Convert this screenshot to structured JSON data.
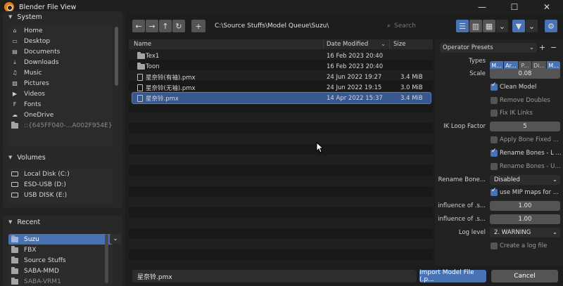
{
  "window": {
    "title": "Blender File View",
    "minimize": "—",
    "maximize": "☐",
    "close": "✕"
  },
  "sidebar": {
    "system": {
      "header": "System",
      "items": [
        {
          "label": "Home",
          "icon": "home-icon",
          "glyph": "⌂"
        },
        {
          "label": "Desktop",
          "icon": "desktop-icon",
          "glyph": "▭"
        },
        {
          "label": "Documents",
          "icon": "documents-icon",
          "glyph": "▤"
        },
        {
          "label": "Downloads",
          "icon": "downloads-icon",
          "glyph": "⤓"
        },
        {
          "label": "Music",
          "icon": "music-icon",
          "glyph": "♫"
        },
        {
          "label": "Pictures",
          "icon": "pictures-icon",
          "glyph": "▨"
        },
        {
          "label": "Videos",
          "icon": "videos-icon",
          "glyph": "▶"
        },
        {
          "label": "Fonts",
          "icon": "fonts-icon",
          "glyph": "F"
        },
        {
          "label": "OneDrive",
          "icon": "onedrive-icon",
          "glyph": "☁"
        },
        {
          "label": "::{645FF040-...A002F954E}",
          "icon": "folder-icon",
          "glyph": ""
        }
      ]
    },
    "volumes": {
      "header": "Volumes",
      "items": [
        {
          "label": "Local Disk (C:)"
        },
        {
          "label": "ESD-USB (D:)"
        },
        {
          "label": "USB DISK (E:)"
        }
      ]
    },
    "recent": {
      "header": "Recent",
      "items": [
        {
          "label": "Suzu"
        },
        {
          "label": "FBX"
        },
        {
          "label": "Source Stuffs"
        },
        {
          "label": "SABA-MMD"
        },
        {
          "label": "SABA-VRM1"
        }
      ]
    }
  },
  "toolbar": {
    "back": "←",
    "forward": "→",
    "parent": "↑",
    "refresh": "↻",
    "new_folder": "+",
    "path": "C:\\Source Stuffs\\Model Queue\\Suzu\\",
    "search_placeholder": "Search",
    "dropdown": "⌄",
    "filter": "▼",
    "gear": "⚙"
  },
  "files": {
    "columns": {
      "name": "Name",
      "date": "Date Modified",
      "size": "Size",
      "sort": "⌄"
    },
    "rows": [
      {
        "name": "Tex1",
        "date": "16 Feb 2023 20:40",
        "size": "",
        "type": "folder"
      },
      {
        "name": "Toon",
        "date": "16 Feb 2023 20:40",
        "size": "",
        "type": "folder"
      },
      {
        "name": "星奈铃(有袖).pmx",
        "date": "24 Jun 2022 19:27",
        "size": "3.4 MiB",
        "type": "file"
      },
      {
        "name": "星奈铃(无袖).pmx",
        "date": "24 Jun 2022 19:15",
        "size": "3.0 MiB",
        "type": "file"
      },
      {
        "name": "星奈铃.pmx",
        "date": "14 Apr 2022 15:37",
        "size": "3.4 MiB",
        "type": "file",
        "selected": true
      }
    ]
  },
  "props": {
    "presets": "Operator Presets",
    "presets_add": "+",
    "presets_remove": "−",
    "types_label": "Types",
    "types": [
      "M...",
      "Ar...",
      "P...",
      "Di...",
      "M..."
    ],
    "types_on": [
      true,
      true,
      false,
      false,
      true
    ],
    "scale_label": "Scale",
    "scale": "0.08",
    "clean_model": "Clean Model",
    "clean_model_on": true,
    "remove_doubles": "Remove Doubles",
    "remove_doubles_on": false,
    "fix_ik": "Fix IK Links",
    "fix_ik_on": false,
    "ik_loop_label": "IK Loop Factor",
    "ik_loop": "5",
    "apply_bone": "Apply Bone Fixed ...",
    "apply_bone_on": false,
    "rename_l": "Rename Bones - L ...",
    "rename_l_on": true,
    "rename_u": "Rename Bones - U...",
    "rename_u_on": false,
    "rename_bone_label": "Rename Bone...",
    "rename_bone": "Disabled",
    "mip": "use MIP maps for ...",
    "mip_on": true,
    "influence1_label": "influence of .s...",
    "influence1": "1.00",
    "influence2_label": "influence of .s...",
    "influence2": "1.00",
    "log_level_label": "Log level",
    "log_level": "2. WARNING",
    "log_file": "Create a log file",
    "log_file_on": false
  },
  "bottom": {
    "filename": "星奈铃.pmx",
    "import": "Import Model File (.p...",
    "cancel": "Cancel"
  },
  "colors": {
    "accent": "#4772b3",
    "selected_row": "#37588f",
    "field": "#545454"
  }
}
